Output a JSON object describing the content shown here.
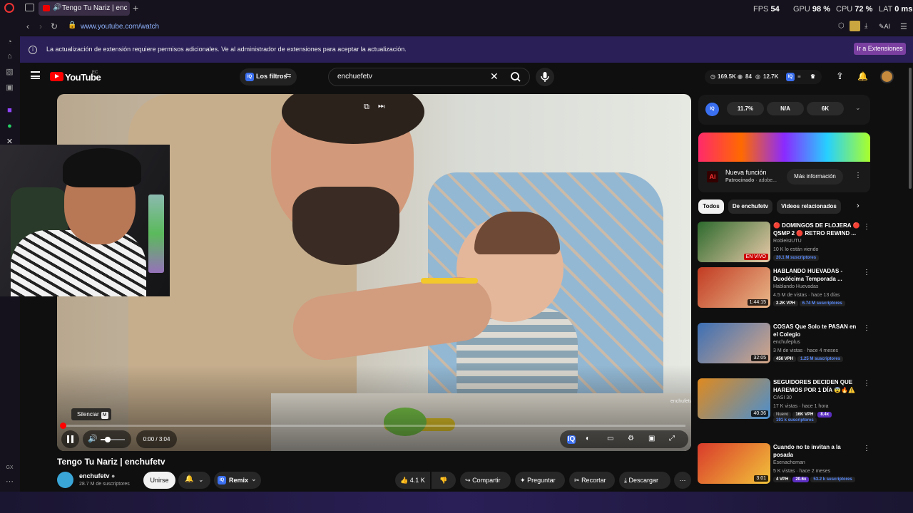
{
  "browser": {
    "tab_title": "Tengo Tu Nariz | enchu",
    "url": "www.youtube.com/watch",
    "stats": [
      {
        "label": "FPS",
        "value": "54"
      },
      {
        "label": "GPU",
        "value": "98 %"
      },
      {
        "label": "CPU",
        "value": "72 %"
      },
      {
        "label": "LAT",
        "value": "0 ms"
      }
    ],
    "ai_label": "AI",
    "sidebar_label": "GX"
  },
  "notice": {
    "text": "La actualización de extensión requiere permisos adicionales. Ve al administrador de extensiones para aceptar la actualización.",
    "button": "Ir a Extensiones"
  },
  "youtube": {
    "logo_text": "YouTube",
    "country": "EC",
    "filters_label": "Los filtros",
    "search_value": "enchuefetv",
    "header_stats": {
      "views": "169.5K",
      "watching": "84",
      "likes": "12.7K"
    }
  },
  "player": {
    "mute_tooltip": "Silenciar",
    "mute_key": "M",
    "time": "0:00 / 3:04",
    "progress": 0.0,
    "volume": 0.3,
    "watermark": "enchufetv"
  },
  "video": {
    "title": "Tengo Tu Nariz | enchufetv",
    "channel": "enchufetv",
    "subscribers": "28.7 M de suscriptores",
    "join_label": "Unirse",
    "remix_label": "Remix",
    "likes": "4.1 K",
    "share_label": "Compartir",
    "ask_label": "Preguntar",
    "clip_label": "Recortar",
    "download_label": "Descargar"
  },
  "iq_panel": {
    "badge": "IQ",
    "values": [
      "11.7%",
      "N/A",
      "6K"
    ]
  },
  "ad": {
    "title": "Nueva función",
    "sponsored": "Patrocinado",
    "advertiser": "adobe...",
    "logo": "Ai",
    "button": "Más información"
  },
  "chips": [
    "Todos",
    "De enchufetv",
    "Videos relacionados"
  ],
  "recommendations": [
    {
      "title": "🔴 DOMINGOS DE FLOJERA 🔴 QSMP 2 🔴 RETRO REWIND ...",
      "channel": "RobleisIUTU",
      "meta": "10 K lo están viendo",
      "badges": [
        "20.1 M suscriptores"
      ],
      "duration": "EN VIVO",
      "thumb": [
        "#2d6a2d",
        "#e8c9a8"
      ]
    },
    {
      "title": "HABLANDO HUEVADAS - Duodécima Temporada ...",
      "channel": "Hablando Huevadas",
      "meta": "4.5 M de vistas · hace 13 días",
      "badges": [
        "2.2K VPH",
        "6.74 M suscriptores"
      ],
      "duration": "1:44:15",
      "thumb": [
        "#c23b22",
        "#e8b88a"
      ]
    },
    {
      "title": "COSAS Que Solo te PASAN en el Colegio",
      "channel": "enchufeplus",
      "meta": "3 M de vistas · hace 4 meses",
      "badges": [
        "456 VPH",
        "1.25 M suscriptores"
      ],
      "duration": "32:05",
      "thumb": [
        "#3b6fb5",
        "#d8a888"
      ]
    },
    {
      "title": "SEGUIDORES DECIDEN QUE HAREMOS POR 1 DÍA 😨🔥⚠️",
      "channel": "CASI 30",
      "meta": "17 K vistas · hace 1 hora",
      "badges": [
        "Nuevo",
        "16K VPH",
        "8.4x",
        "191 k suscriptores"
      ],
      "duration": "40:36",
      "thumb": [
        "#e08a1e",
        "#4a8fd0"
      ]
    },
    {
      "title": "Cuando no te invitan a la posada",
      "channel": "Esenachoman",
      "meta": "5 K vistas · hace 2 meses",
      "badges": [
        "4 VPH",
        "20.6x",
        "53.2 k suscriptores"
      ],
      "duration": "3:01",
      "thumb": [
        "#d93a2b",
        "#f2c33a"
      ]
    }
  ],
  "colors": {
    "accent": "#ff0000",
    "notice_bg": "#2a1f57",
    "chip_active": "#f1f1f1"
  }
}
